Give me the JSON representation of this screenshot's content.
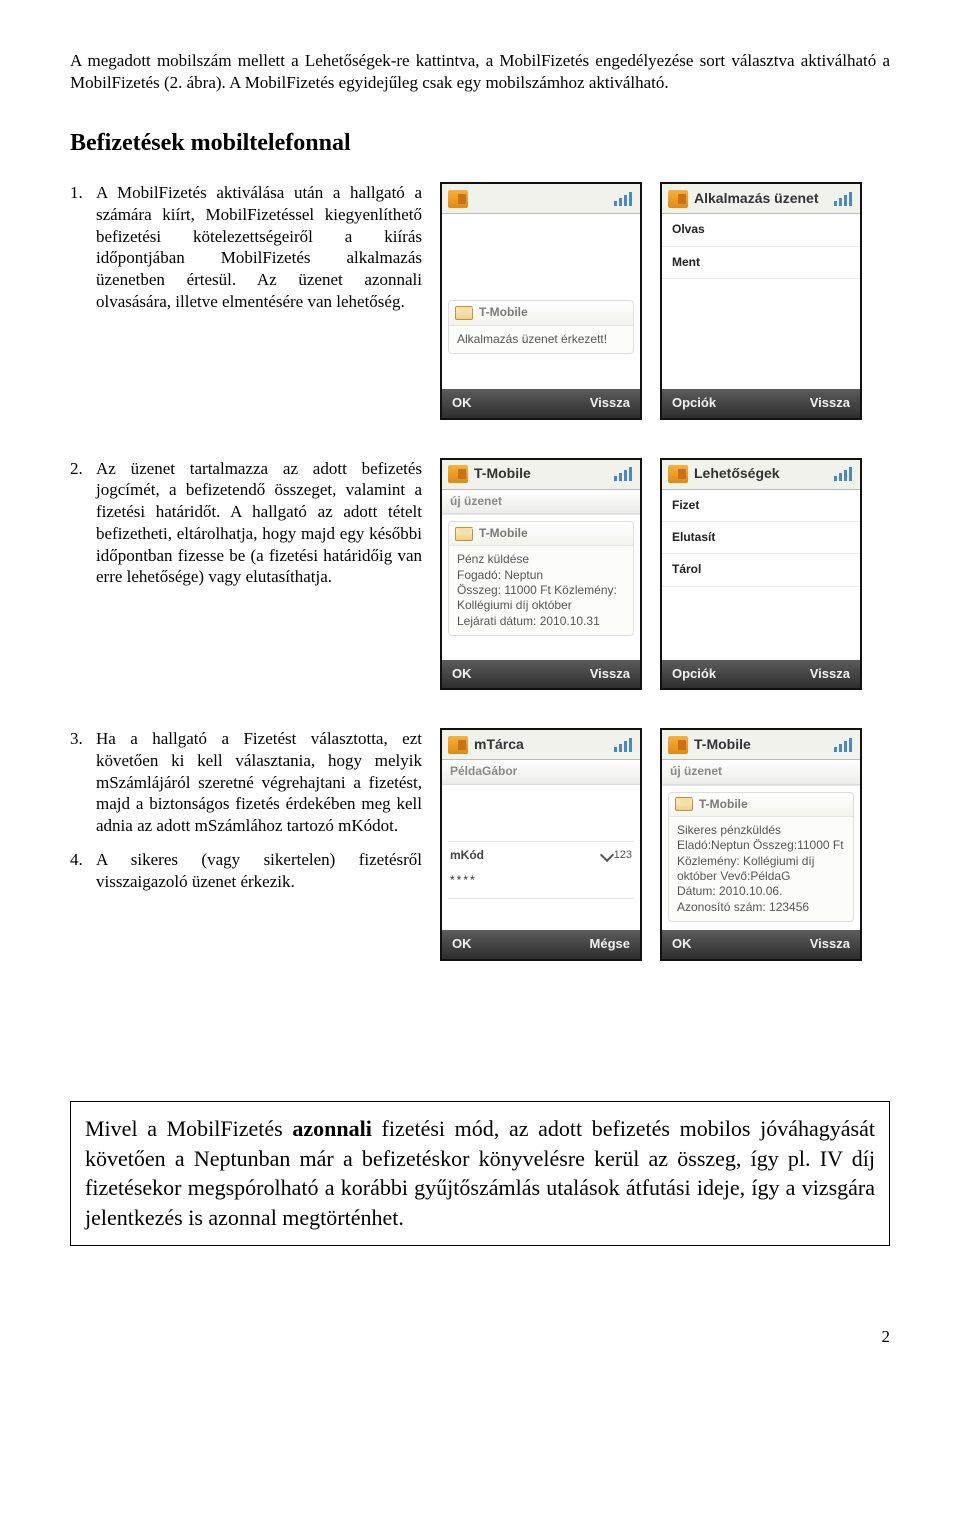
{
  "intro": {
    "p1": "A megadott mobilszám mellett a Lehetőségek-re kattintva, a MobilFizetés engedélyezése sort választva aktiválható a MobilFizetés (2. ábra). A MobilFizetés egyidejűleg csak egy mobilszámhoz aktiválható."
  },
  "section_title": "Befizetések mobiltelefonnal",
  "steps": {
    "s1": "A MobilFizetés aktiválása után a hallgató a számára kiírt, MobilFizetéssel kiegyenlíthető befizetési kötelezettségeiről a kiírás időpontjában MobilFizetés alkalmazás üzenetben értesül. Az üzenet azonnali olvasására, illetve elmentésére van lehetőség.",
    "s2": "Az üzenet tartalmazza az adott befizetés jogcímét, a befizetendő összeget, valamint a fizetési határidőt. A hallgató az adott tételt befizetheti, eltárolhatja, hogy majd egy későbbi időpontban fizesse be (a fizetési határidőig van erre lehetősége) vagy elutasíthatja.",
    "s3": "Ha a hallgató a Fizetést választotta, ezt követően ki kell választania, hogy melyik mSzámlájáról szeretné végrehajtani a fizetést, majd a biztonságos fizetés érdekében meg kell adnia az adott mSzámlához tartozó mKódot.",
    "s4": "A sikeres (vagy sikertelen) fizetésről visszaigazoló üzenet érkezik."
  },
  "phone1a": {
    "card_title": "T-Mobile",
    "card_body": "Alkalmazás üzenet érkezett!",
    "left": "OK",
    "right": "Vissza"
  },
  "phone1b": {
    "title": "Alkalmazás üzenet",
    "item1": "Olvas",
    "item2": "Ment",
    "left": "Opciók",
    "right": "Vissza"
  },
  "phone2a": {
    "card_title": "T-Mobile",
    "sub": "új üzenet",
    "msg_title": "T-Mobile",
    "msg_body": "Pénz küldése\nFogadó: Neptun\nÖsszeg: 11000 Ft Közlemény:\nKollégiumi díj október\nLejárati dátum: 2010.10.31",
    "left": "OK",
    "right": "Vissza"
  },
  "phone2b": {
    "title": "Lehetőségek",
    "item1": "Fizet",
    "item2": "Elutasít",
    "item3": "Tárol",
    "left": "Opciók",
    "right": "Vissza"
  },
  "phone3a": {
    "title": "mTárca",
    "name": "PéldaGábor",
    "input_label": "mKód",
    "mode": "123",
    "dots": "****",
    "left": "OK",
    "right": "Mégse"
  },
  "phone3b": {
    "card_title": "T-Mobile",
    "sub": "új üzenet",
    "msg_title": "T-Mobile",
    "msg_body": "Sikeres pénzküldés\nEladó:Neptun Összeg:11000 Ft\nKözlemény: Kollégiumi díj\noktóber Vevő:PéldaG\nDátum: 2010.10.06.\nAzonosító szám: 123456",
    "left": "OK",
    "right": "Vissza"
  },
  "note": {
    "text_pre": "Mivel a MobilFizetés ",
    "bold": "azonnali",
    "text_post": " fizetési mód, az adott befizetés mobilos jóváhagyását követően a Neptunban már a befizetéskor könyvelésre kerül az összeg, így pl. IV díj fizetésekor megspórolható a korábbi gyűjtőszámlás utalások átfutási ideje, így a vizsgára jelentkezés is azonnal megtörténhet."
  },
  "page_number": "2"
}
